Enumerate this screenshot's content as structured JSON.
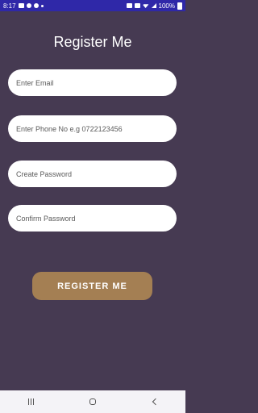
{
  "status_bar": {
    "time": "8:17",
    "battery": "100%",
    "left_icons": [
      "image-icon",
      "messenger-icon",
      "chat-icon",
      "dot-icon"
    ],
    "right_icons": [
      "alarm-icon",
      "vibrate-icon",
      "wifi-icon",
      "signal-icon",
      "battery-icon"
    ]
  },
  "page": {
    "title": "Register Me"
  },
  "form": {
    "email_placeholder": "Enter Email",
    "phone_placeholder": "Enter Phone No e.g 0722123456",
    "password_placeholder": "Create Password",
    "confirm_placeholder": "Confirm Password",
    "submit_label": "REGISTER ME"
  },
  "colors": {
    "background": "#463a52",
    "status_bar": "#2f28a8",
    "button": "#a47f53",
    "field": "#ffffff"
  },
  "nav_bar": {
    "icons": [
      "recents-icon",
      "home-icon",
      "back-icon"
    ]
  }
}
